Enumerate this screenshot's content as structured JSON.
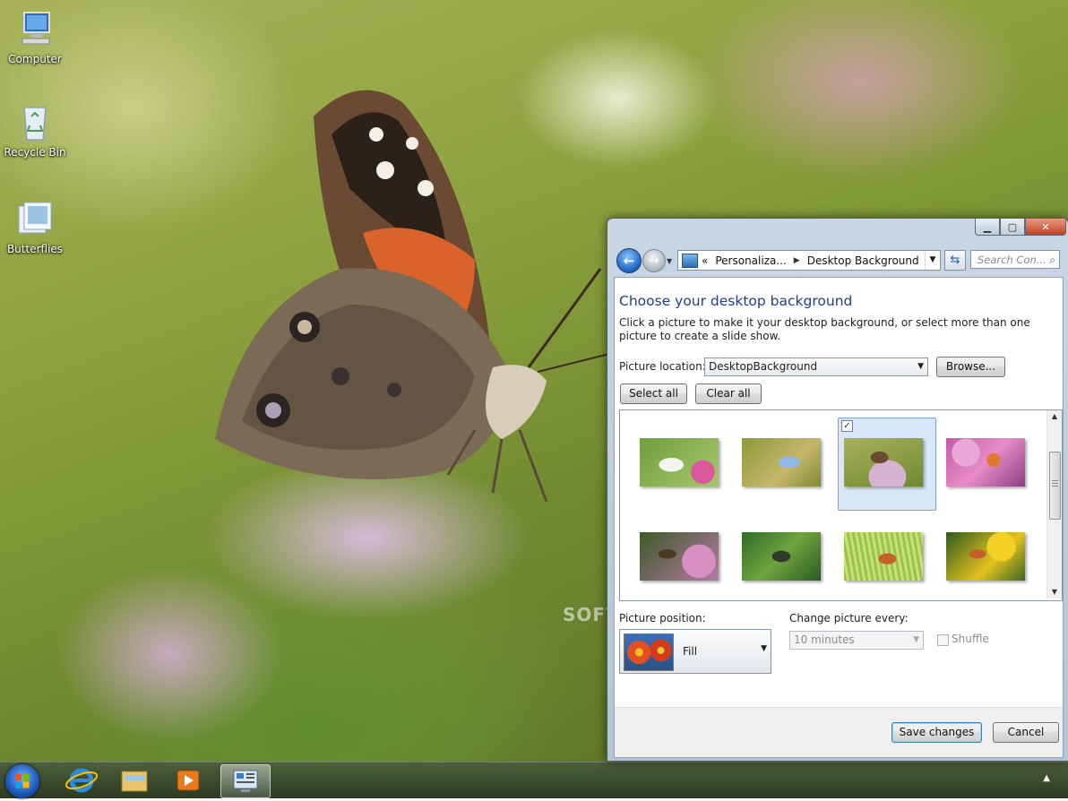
{
  "desktop": {
    "icons": [
      {
        "label": "Computer"
      },
      {
        "label": "Recycle Bin"
      },
      {
        "label": "Butterflies"
      }
    ]
  },
  "watermark": "SOFTP",
  "window": {
    "address": {
      "prefix": "«",
      "segments": [
        "Personaliza...",
        "Desktop Background"
      ]
    },
    "search_placeholder": "Search Con...",
    "title": "Choose your desktop background",
    "description": "Click a picture to make it your desktop background, or select more than one picture to create a slide show.",
    "picture_location": {
      "label": "Picture location:",
      "value": "DesktopBackground",
      "browse": "Browse..."
    },
    "select_all": "Select all",
    "clear_all": "Clear all",
    "gallery": {
      "selected_index": 2,
      "items": [
        {
          "name": "white-butterfly-pink-flowers"
        },
        {
          "name": "blue-butterfly-green"
        },
        {
          "name": "painted-lady-flowers"
        },
        {
          "name": "orange-butterfly-pink-flowers"
        },
        {
          "name": "dark-butterfly-pink"
        },
        {
          "name": "green-butterfly-leaves"
        },
        {
          "name": "orange-butterfly-grass"
        },
        {
          "name": "butterfly-yellow-flowers"
        }
      ]
    },
    "picture_position": {
      "label": "Picture position:",
      "value": "Fill"
    },
    "change_every": {
      "label": "Change picture every:",
      "value": "10 minutes"
    },
    "shuffle": {
      "label": "Shuffle",
      "checked": false
    },
    "save": "Save changes",
    "cancel": "Cancel"
  },
  "colors": {
    "title_blue": "#1e3f87",
    "selection_fill": "#d9e8f8"
  }
}
